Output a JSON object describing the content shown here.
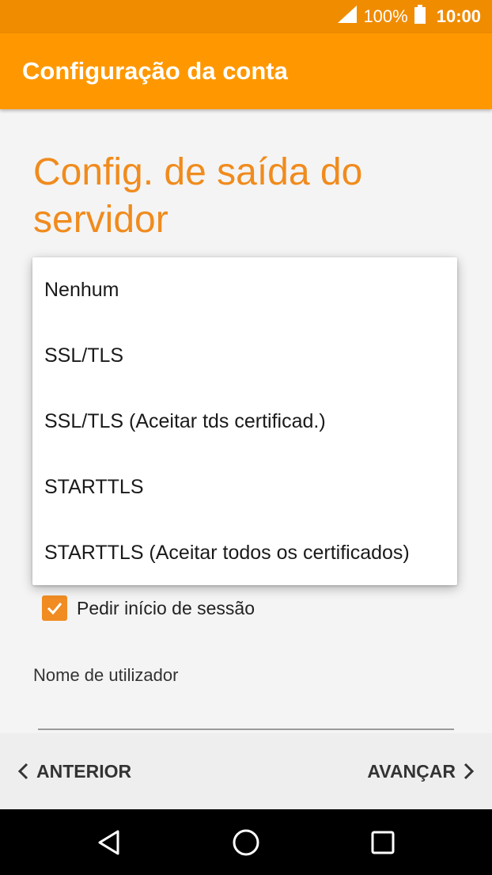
{
  "status_bar": {
    "battery": "100%",
    "time": "10:00"
  },
  "app_bar": {
    "title": "Configuração da conta"
  },
  "page": {
    "heading": "Config. de saída do servidor"
  },
  "security_dropdown": {
    "options": [
      "Nenhum",
      "SSL/TLS",
      "SSL/TLS (Aceitar tds certificad.)",
      "STARTTLS",
      "STARTTLS (Aceitar todos os certificados)"
    ]
  },
  "login_checkbox": {
    "label": "Pedir início de sessão",
    "checked": true
  },
  "username": {
    "label": "Nome de utilizador",
    "value": ""
  },
  "bottom_nav": {
    "previous_label": "ANTERIOR",
    "next_label": "AVANÇAR"
  },
  "colors": {
    "status_bar": "#f08c00",
    "app_bar": "#ff9800",
    "accent": "#f08b1d"
  },
  "icons": {
    "signal": "signal-icon",
    "battery": "battery-icon",
    "prev": "chevron-left-icon",
    "next": "chevron-right-icon",
    "back": "back-triangle-icon",
    "home": "home-circle-icon",
    "recents": "recents-square-icon",
    "check": "check-icon"
  }
}
